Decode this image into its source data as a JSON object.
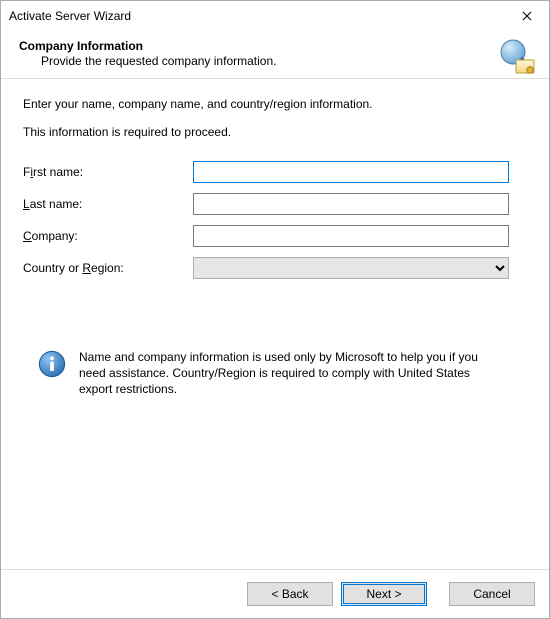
{
  "window": {
    "title": "Activate Server Wizard"
  },
  "header": {
    "title": "Company Information",
    "subtitle": "Provide the requested company information."
  },
  "body": {
    "intro1": "Enter your name, company name, and country/region information.",
    "intro2": "This information is required to proceed.",
    "fields": {
      "first_name": {
        "label_pre": "F",
        "label_accel": "i",
        "label_post": "rst name:",
        "value": ""
      },
      "last_name": {
        "label_pre": "",
        "label_accel": "L",
        "label_post": "ast name:",
        "value": ""
      },
      "company": {
        "label_pre": "",
        "label_accel": "C",
        "label_post": "ompany:",
        "value": ""
      },
      "region": {
        "label_pre": "Country or ",
        "label_accel": "R",
        "label_post": "egion:",
        "value": ""
      }
    },
    "info": "Name and company information is used only by Microsoft to help you if you need assistance. Country/Region is required to comply with United States export restrictions."
  },
  "footer": {
    "back": "< Back",
    "next": "Next >",
    "cancel": "Cancel"
  }
}
